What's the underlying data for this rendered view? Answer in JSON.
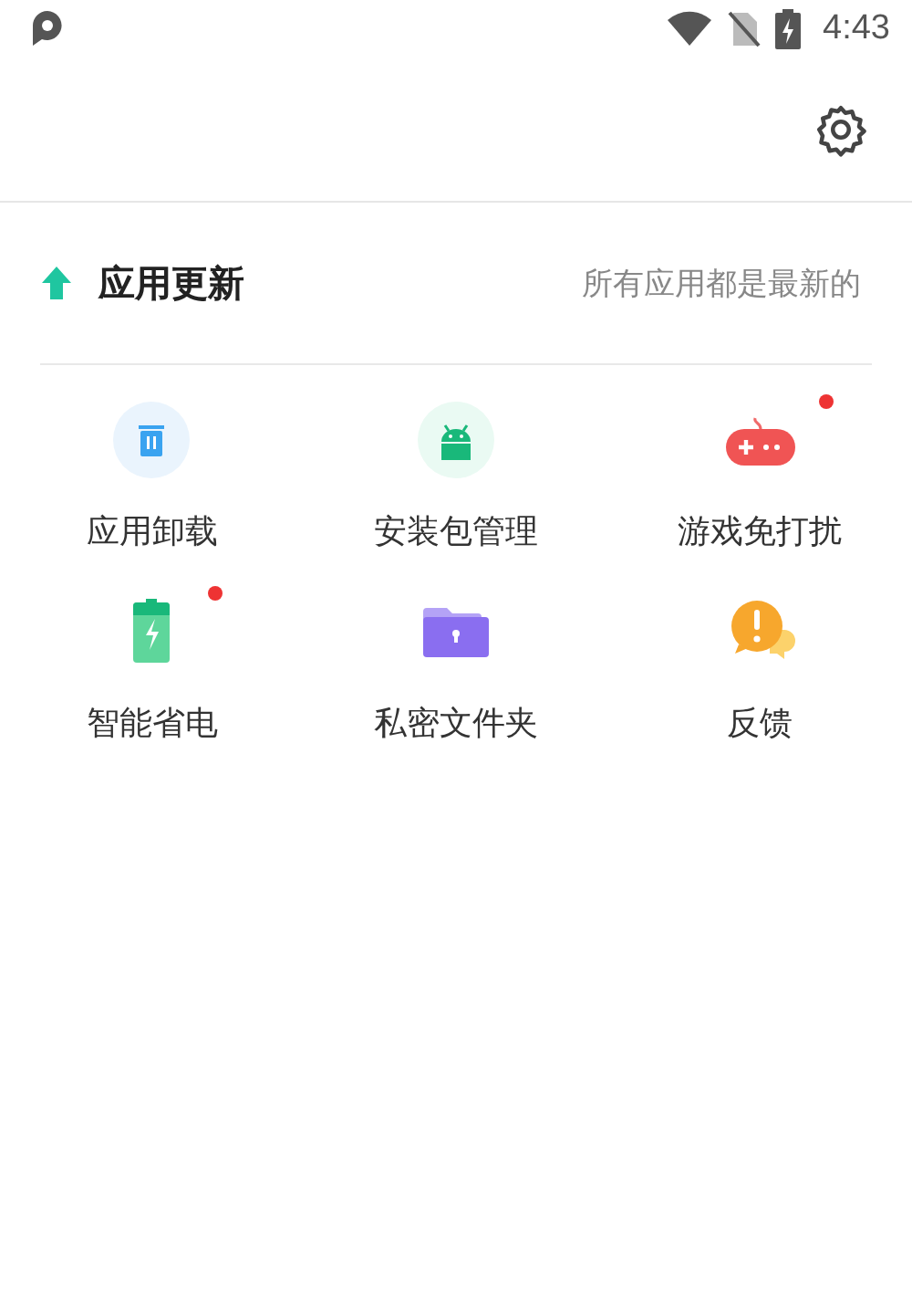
{
  "status_bar": {
    "time": "4:43"
  },
  "section": {
    "title": "应用更新",
    "status": "所有应用都是最新的"
  },
  "tools": [
    {
      "kind": "trash",
      "label": "应用卸载",
      "badge": false
    },
    {
      "kind": "android",
      "label": "安装包管理",
      "badge": false
    },
    {
      "kind": "gamepad",
      "label": "游戏免打扰",
      "badge": true
    },
    {
      "kind": "battery",
      "label": "智能省电",
      "badge": true
    },
    {
      "kind": "folder",
      "label": "私密文件夹",
      "badge": false
    },
    {
      "kind": "feedback",
      "label": "反馈",
      "badge": false
    }
  ]
}
